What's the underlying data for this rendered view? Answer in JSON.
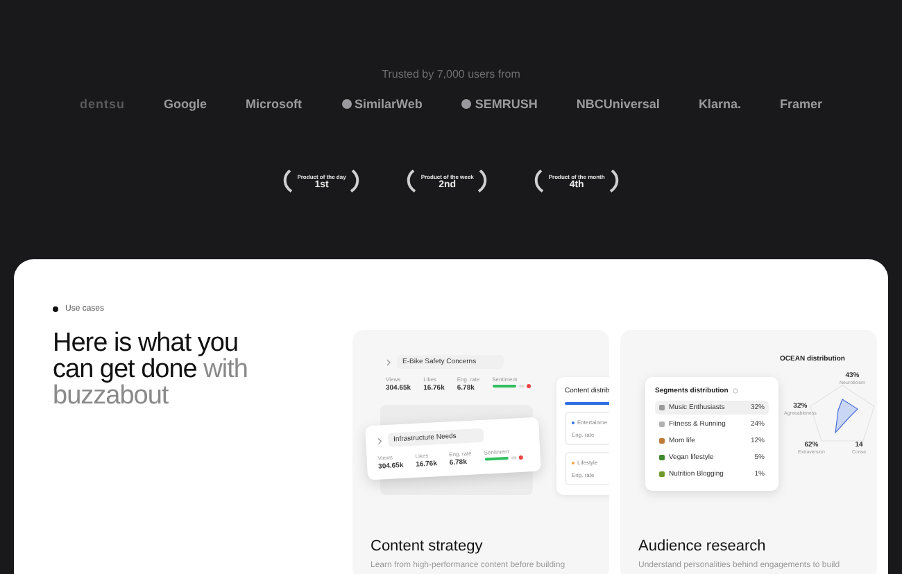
{
  "trusted": "Trusted by 7,000 users from",
  "logos": [
    {
      "text": "dentsu",
      "kind": "faded"
    },
    {
      "text": "Google",
      "kind": "plain"
    },
    {
      "text": "Microsoft",
      "kind": "plain"
    },
    {
      "text": "SimilarWeb",
      "kind": "mark"
    },
    {
      "text": "SEMRUSH",
      "kind": "mark"
    },
    {
      "text": "NBCUniversal",
      "kind": "plain"
    },
    {
      "text": "Klarna.",
      "kind": "plain"
    },
    {
      "text": "Framer",
      "kind": "plain"
    }
  ],
  "awards": [
    {
      "title": "Product of the day",
      "rank": "1st"
    },
    {
      "title": "Product of the week",
      "rank": "2nd"
    },
    {
      "title": "Product of the month",
      "rank": "4th"
    }
  ],
  "section": {
    "label": "Use cases",
    "heading": "Here is what you can get done",
    "heading_accent": "with buzzabout"
  },
  "cards": [
    {
      "kind": "content",
      "title": "Content strategy",
      "description": "Learn from high-performance content before building",
      "posts": [
        {
          "topic": "E-Bike Safety Concerns",
          "sentiment_label": "Sentiment",
          "stats": [
            {
              "label": "Views",
              "value": "304.65k"
            },
            {
              "label": "Likes",
              "value": "16.76k"
            },
            {
              "label": "Eng. rate",
              "value": "6.78k"
            }
          ]
        },
        {
          "topic": "Infrastructure Needs",
          "sentiment_label": "Sentiment",
          "stats": [
            {
              "label": "Views",
              "value": "304.65k"
            },
            {
              "label": "Likes",
              "value": "16.76k"
            },
            {
              "label": "Eng. rate",
              "value": "6.78k"
            }
          ]
        }
      ],
      "distribution": {
        "title": "Content distrib",
        "groups": [
          {
            "name": "Entertainme",
            "metric": "Eng. rate",
            "color": "#2f6fe4"
          },
          {
            "name": "Lifestyle",
            "metric": "Eng. rate",
            "color": "#f0a238"
          }
        ]
      }
    },
    {
      "kind": "audience",
      "title": "Audience research",
      "description": "Understand personalities behind engagements to build",
      "segments": {
        "title": "Segments distribution",
        "rows": [
          {
            "name": "Music Enthusiasts",
            "share": "32%",
            "selected": true,
            "color": "#9a9a9a"
          },
          {
            "name": "Fitness & Running",
            "share": "24%",
            "selected": false,
            "color": "#b0b0b0"
          },
          {
            "name": "Mom life",
            "share": "12%",
            "selected": false,
            "color": "#c07a3a"
          },
          {
            "name": "Vegan lifestyle",
            "share": "5%",
            "selected": false,
            "color": "#3f8a2e"
          },
          {
            "name": "Nutrition Blogging",
            "share": "1%",
            "selected": false,
            "color": "#6f9a2a"
          }
        ]
      },
      "ocean": {
        "title": "OCEAN distribution",
        "traits": [
          {
            "value": "43%",
            "name": "Neuroticism"
          },
          {
            "value": "32%",
            "name": "Agreeableness"
          },
          {
            "value": "62%",
            "name": "Extraversion"
          },
          {
            "value": "14",
            "name": "Conse"
          }
        ]
      }
    }
  ]
}
